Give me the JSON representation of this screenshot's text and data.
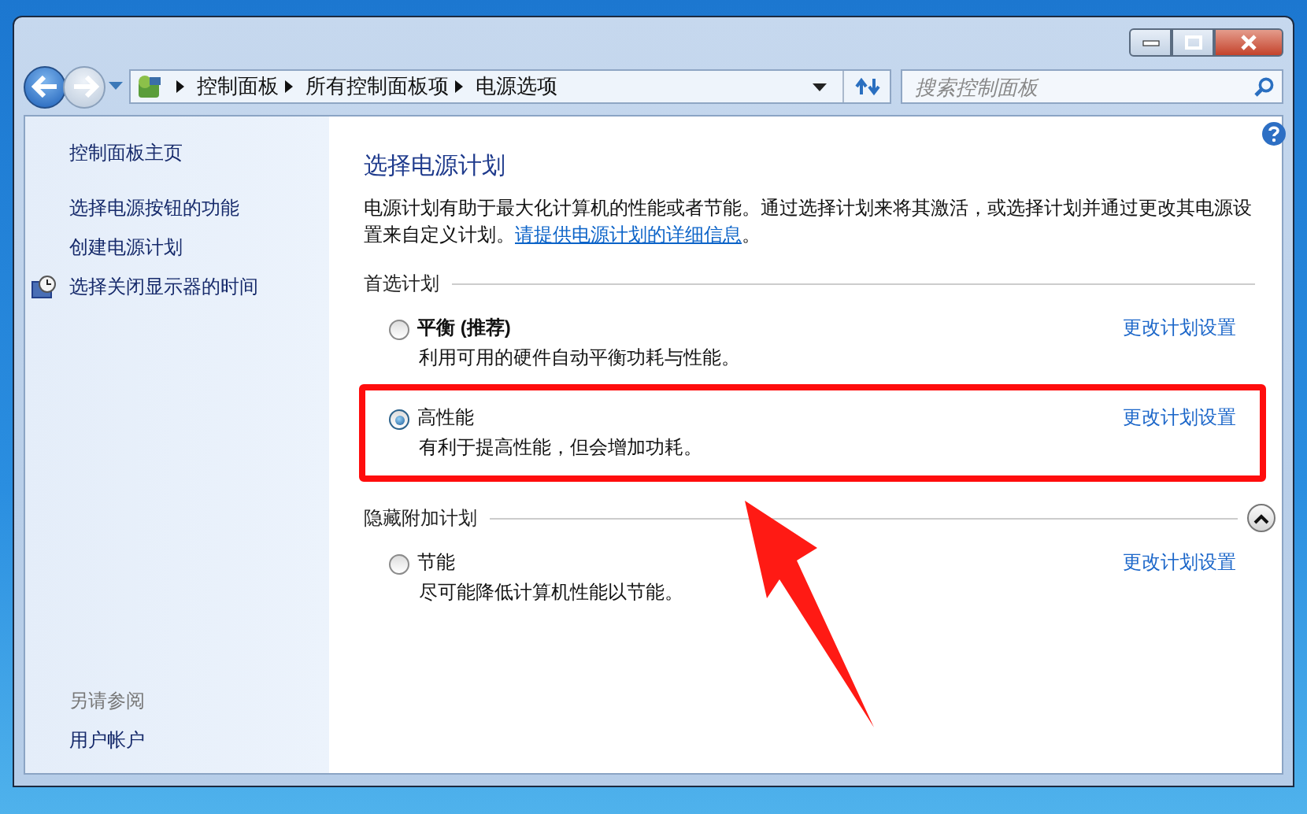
{
  "address_bar": {
    "crumbs": [
      "控制面板",
      "所有控制面板项",
      "电源选项"
    ]
  },
  "search": {
    "placeholder": "搜索控制面板"
  },
  "sidebar": {
    "home": "控制面板主页",
    "links": [
      "选择电源按钮的功能",
      "创建电源计划",
      {
        "text": "选择关闭显示器的时间",
        "kind": "icon"
      }
    ],
    "see_also": {
      "heading": "另请参阅",
      "links": [
        "用户帐户"
      ]
    }
  },
  "main": {
    "title": "选择电源计划",
    "description": "电源计划有助于最大化计算机的性能或者节能。通过选择计划来将其激活，或选择计划并通过更改其电源设置来自定义计划。",
    "link": "请提供电源计划的详细信息",
    "description_end": "。",
    "sections": [
      {
        "heading": "首选计划",
        "kind": "fixed",
        "plans": [
          {
            "name": "平衡 (推荐)",
            "recommended": true,
            "selected": false,
            "highlighted": false,
            "description": "利用可用的硬件自动平衡功耗与性能。",
            "link": "更改计划设置"
          },
          {
            "name": "高性能",
            "recommended": false,
            "selected": true,
            "highlighted": true,
            "description": "有利于提高性能，但会增加功耗。",
            "link": "更改计划设置"
          }
        ]
      },
      {
        "heading": "隐藏附加计划",
        "kind": "collapsible",
        "expanded": true,
        "plans": [
          {
            "name": "节能",
            "recommended": false,
            "selected": false,
            "highlighted": false,
            "description": "尽可能降低计算机性能以节能。",
            "link": "更改计划设置"
          }
        ]
      }
    ]
  }
}
